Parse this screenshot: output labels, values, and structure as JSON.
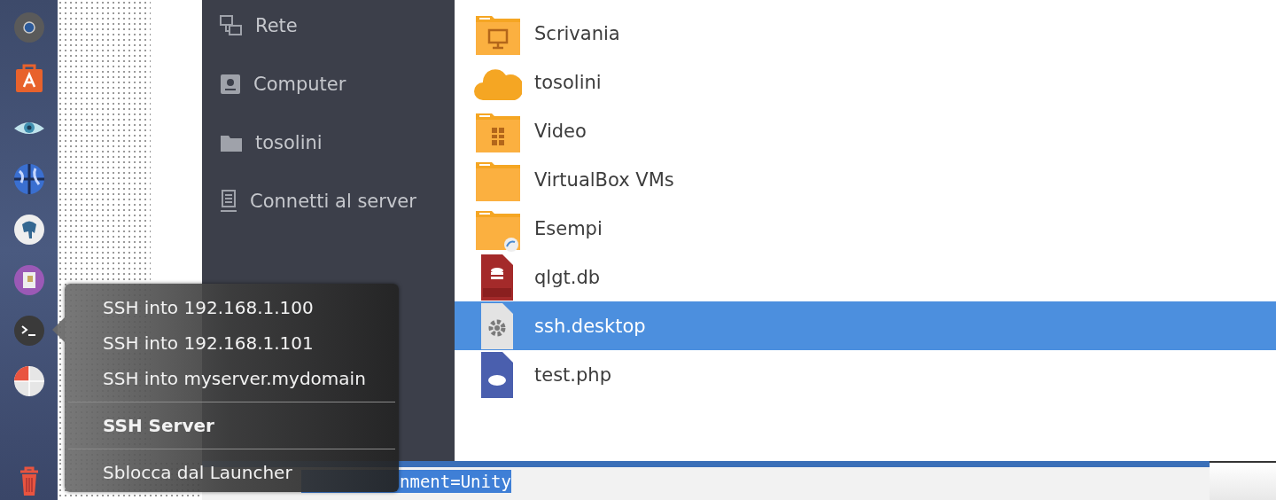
{
  "sidebar": {
    "items": [
      {
        "kind": "network",
        "label": "Rete"
      },
      {
        "kind": "computer",
        "label": "Computer"
      },
      {
        "kind": "folder",
        "label": "tosolini"
      },
      {
        "kind": "server",
        "label": "Connetti al server"
      }
    ]
  },
  "files": [
    {
      "kind": "folder-desktop",
      "name": "Scrivania",
      "selected": false
    },
    {
      "kind": "cloud",
      "name": "tosolini",
      "selected": false
    },
    {
      "kind": "folder-video",
      "name": "Video",
      "selected": false
    },
    {
      "kind": "folder",
      "name": "VirtualBox VMs",
      "selected": false
    },
    {
      "kind": "folder-link",
      "name": "Esempi",
      "selected": false
    },
    {
      "kind": "sql",
      "name": "qlgt.db",
      "selected": false
    },
    {
      "kind": "desktop",
      "name": "ssh.desktop",
      "selected": true
    },
    {
      "kind": "php",
      "name": "test.php",
      "selected": false
    }
  ],
  "editor": {
    "line": "nment=Unity"
  },
  "context_menu": {
    "items": [
      {
        "kind": "action",
        "label": "SSH into 192.168.1.100"
      },
      {
        "kind": "action",
        "label": "SSH into 192.168.1.101"
      },
      {
        "kind": "action",
        "label": "SSH into myserver.mydomain"
      },
      {
        "kind": "separator"
      },
      {
        "kind": "title",
        "label": "SSH Server"
      },
      {
        "kind": "separator"
      },
      {
        "kind": "action",
        "label": "Sblocca dal Launcher"
      }
    ]
  }
}
